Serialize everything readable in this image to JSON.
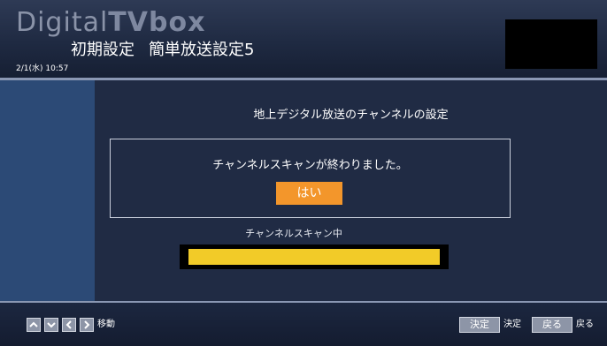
{
  "header": {
    "logo_light": "Digital",
    "logo_bold": "TVbox",
    "title_part1": "初期設定",
    "title_part2": "簡単放送設定5",
    "datetime": "2/1(水) 10:57"
  },
  "main": {
    "heading": "地上デジタル放送のチャンネルの設定",
    "dialog": {
      "message": "チャンネルスキャンが終わりました。",
      "yes_label": "はい"
    },
    "scan_label": "チャンネルスキャン中",
    "progress": 1.0
  },
  "footer": {
    "nav_icons": [
      "arrow-up-icon",
      "arrow-down-icon",
      "arrow-left-icon",
      "arrow-right-icon"
    ],
    "move_label": "移動",
    "decide_key": "決定",
    "decide_label": "決定",
    "back_key": "戻る",
    "back_label": "戻る"
  },
  "colors": {
    "accent_button": "#f3962b",
    "progress_bar": "#f2cb28",
    "left_rail": "#2c4a76",
    "background": "#202b44"
  }
}
